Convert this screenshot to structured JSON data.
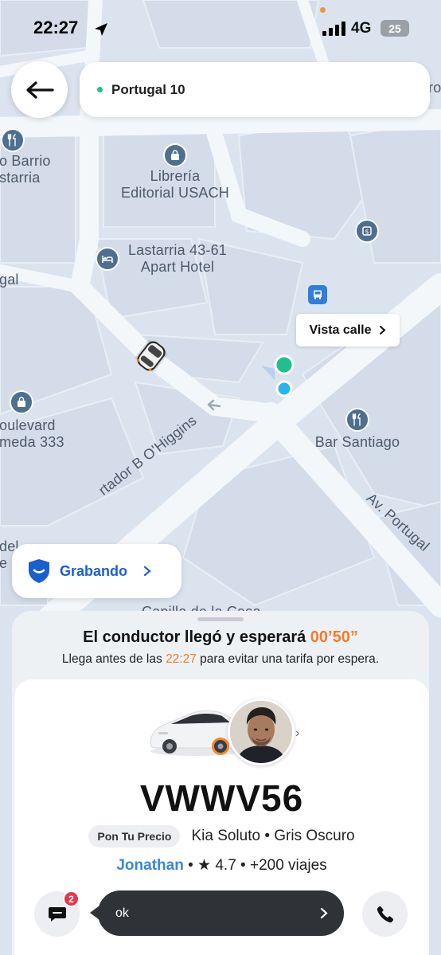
{
  "status_bar": {
    "time": "22:27",
    "network": "4G",
    "battery": "25"
  },
  "header": {
    "destination": "Portugal 10"
  },
  "map": {
    "labels": {
      "barrio": "o Barrio\nstarria",
      "libreria": "Librería\nEditorial USACH",
      "apart_hotel": "Lastarria 43-61\nApart Hotel",
      "gal": "gal",
      "boulevard": "oulevard\nmeda 333",
      "bar": "Bar Santiago",
      "ohiggins": "rtador B O'Higgins",
      "portugal_ave": "Av. Portugal",
      "del": "del\ne",
      "capilla": "Capilla de la Casa",
      "edge_ro": "ro"
    },
    "street_view_label": "Vista calle",
    "recording_label": "Grabando"
  },
  "trip": {
    "wait_title": "El conductor llegó y esperará",
    "wait_timer": "00’50”",
    "wait_sub_prefix": "Llega antes de las",
    "wait_sub_time": "22:27",
    "wait_sub_suffix": "para evitar una tarifa por espera.",
    "plate": "VWWV56",
    "fare_tag": "Pon Tu Precio",
    "car_model": "Kia Soluto • Gris Oscuro",
    "driver_name": "Jonathan",
    "rating_sep": "•",
    "rating": "★ 4.7",
    "trips_sep": "•",
    "trips": "+200 viajes",
    "unread_count": "2",
    "last_message": "ok"
  },
  "colors": {
    "accent_orange": "#f07d2b",
    "link_blue": "#3a86d9",
    "shield_blue": "#1a5fd0",
    "pickup_green": "#1fbf8f",
    "user_blue": "#2ab4ee",
    "badge_red": "#e8364d"
  },
  "icons": {
    "back": "arrow-left-icon",
    "location": "location-arrow-icon",
    "shield": "shield-icon",
    "chat": "chat-icon",
    "phone": "phone-icon"
  }
}
